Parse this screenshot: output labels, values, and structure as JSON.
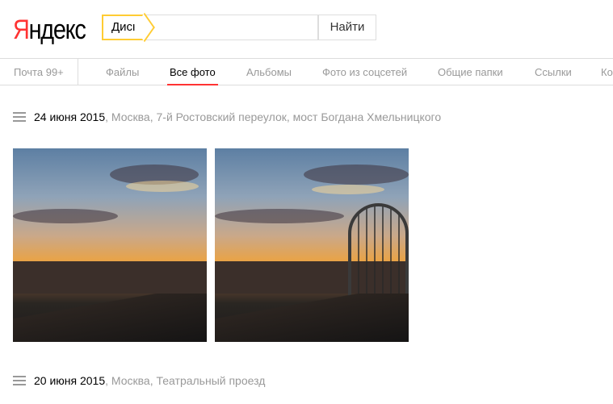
{
  "logo": {
    "text": "Яндекс",
    "first": "Я",
    "rest": "ндекс"
  },
  "search": {
    "service": "Диск",
    "value": "",
    "button": "Найти"
  },
  "nav": {
    "mail": "Почта 99+",
    "items": [
      "Файлы",
      "Все фото",
      "Альбомы",
      "Фото из соцсетей",
      "Общие папки",
      "Ссылки",
      "Ко"
    ],
    "active": "Все фото"
  },
  "groups": [
    {
      "date": "24 июня 2015",
      "place": ", Москва, 7-й Ростовский переулок, мост Богдана Хмельницкого"
    },
    {
      "date": "20 июня 2015",
      "place": ", Москва, Театральный проезд"
    }
  ],
  "colors": {
    "accent": "#ff3333",
    "search_border": "#ffcc33"
  }
}
